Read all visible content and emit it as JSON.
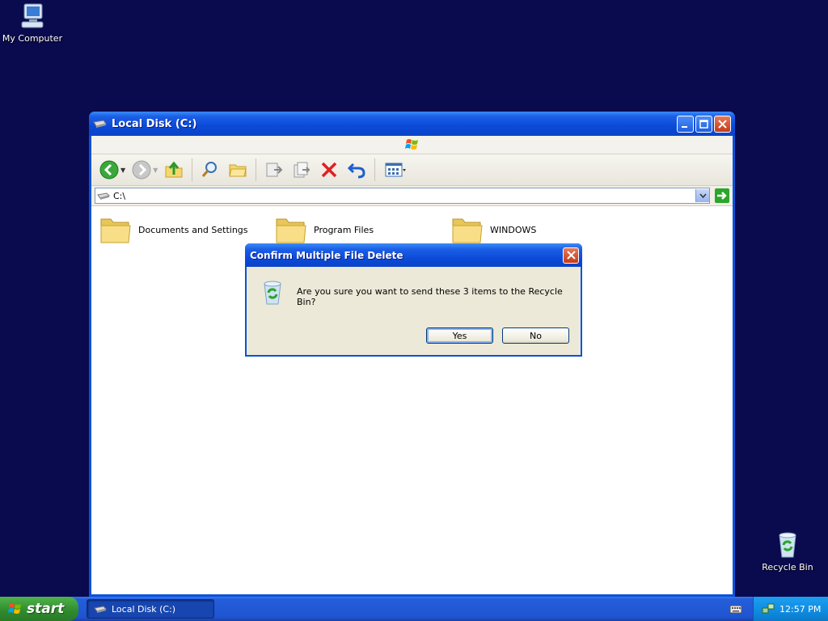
{
  "desktop": {
    "my_computer_label": "My Computer",
    "recycle_bin_label": "Recycle Bin"
  },
  "window": {
    "title": "Local Disk (C:)",
    "address": "C:\\",
    "files": [
      {
        "name": "Documents and Settings"
      },
      {
        "name": "Program Files"
      },
      {
        "name": "WINDOWS"
      }
    ]
  },
  "dialog": {
    "title": "Confirm Multiple File Delete",
    "message": "Are you sure you want to send these 3 items to the Recycle Bin?",
    "yes_label": "Yes",
    "no_label": "No"
  },
  "taskbar": {
    "start_label": "start",
    "task_label": "Local Disk (C:)",
    "clock": "12:57 PM"
  },
  "icons": {
    "back": "back-arrow-icon",
    "forward": "forward-arrow-icon",
    "up": "up-folder-icon",
    "search": "search-icon",
    "folders": "folders-icon",
    "move_to": "move-to-icon",
    "copy_to": "copy-to-icon",
    "delete": "delete-icon",
    "undo": "undo-icon",
    "views": "views-icon"
  },
  "colors": {
    "desktop_bg": "#0a0a4e",
    "titlebar": "#0b4ad8",
    "start_green": "#2f8a2c"
  }
}
